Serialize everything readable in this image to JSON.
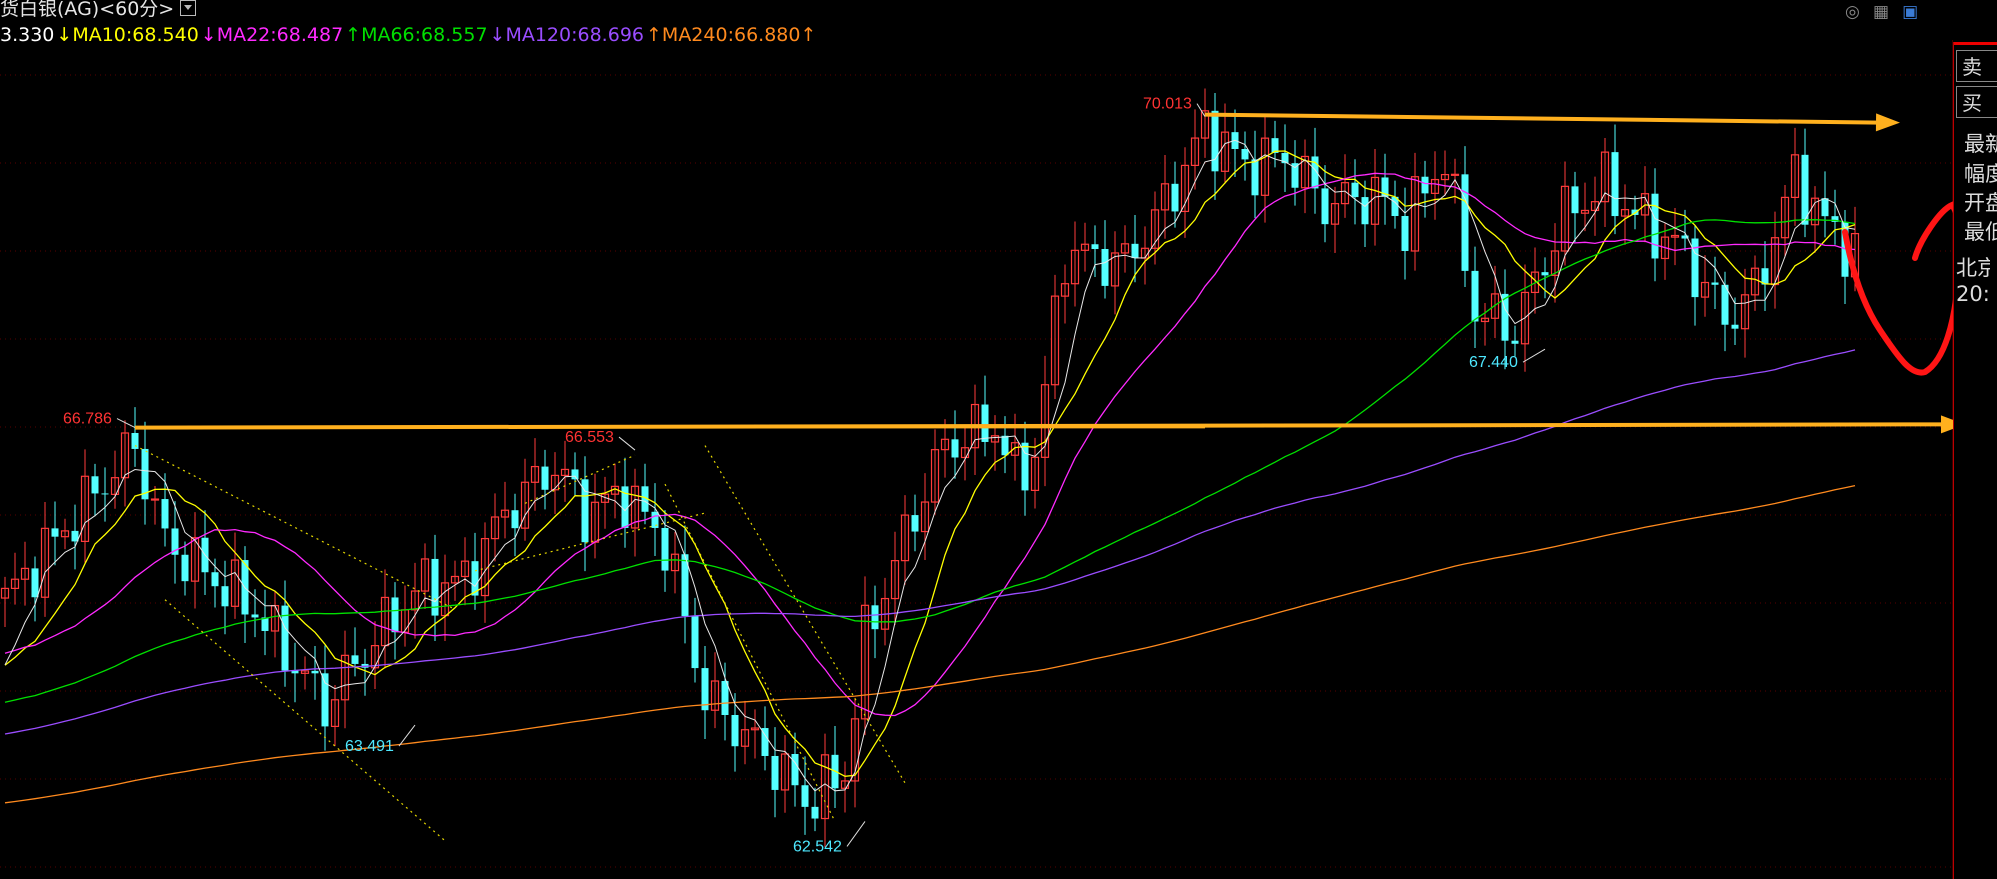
{
  "header": {
    "title": "货白银(AG)<60分>",
    "items": [
      {
        "text": "3.330",
        "color": "#ffffff"
      },
      {
        "text": "↓MA10:68.540",
        "color": "#ffff00"
      },
      {
        "text": "↓MA22:68.487",
        "color": "#ff2aff"
      },
      {
        "text": "↑MA66:68.557",
        "color": "#00e000"
      },
      {
        "text": "↓MA120:68.696",
        "color": "#9a4dff"
      },
      {
        "text": "↑MA240:66.880↑",
        "color": "#ff8a1e"
      }
    ]
  },
  "top_icons": [
    "eye-off-icon",
    "grid-icon",
    "layout-icon"
  ],
  "right_panel": {
    "buttons": [
      "卖出",
      "买入"
    ],
    "labels": [
      "最新",
      "幅度",
      "开盘",
      "最低",
      "北京",
      "20:"
    ]
  },
  "chart_data": {
    "type": "candlestick",
    "title": "",
    "annotations": [
      {
        "label": "70.013",
        "kind": "high",
        "color": "#ff3333"
      },
      {
        "label": "66.786",
        "kind": "high",
        "color": "#ff3333"
      },
      {
        "label": "66.553",
        "kind": "high",
        "color": "#ff3333"
      },
      {
        "label": "67.440",
        "kind": "low",
        "color": "#4ee8ff"
      },
      {
        "label": "63.491",
        "kind": "low",
        "color": "#4ee8ff"
      },
      {
        "label": "62.542",
        "kind": "low",
        "color": "#4ee8ff"
      }
    ],
    "ma_series": [
      {
        "name": "MA10",
        "color": "#ffff00"
      },
      {
        "name": "MA22",
        "color": "#ff2aff"
      },
      {
        "name": "MA66",
        "color": "#00e000"
      },
      {
        "name": "MA120",
        "color": "#9a4dff"
      },
      {
        "name": "MA240",
        "color": "#ff8a1e"
      }
    ],
    "key_points": [
      {
        "t": 0,
        "v": 65.0
      },
      {
        "t": 13,
        "v": 66.6
      },
      {
        "t": 16,
        "v": 65.6
      },
      {
        "t": 25,
        "v": 64.9
      },
      {
        "t": 32,
        "v": 63.9
      },
      {
        "t": 34,
        "v": 64.2
      },
      {
        "t": 41,
        "v": 65.1
      },
      {
        "t": 46,
        "v": 65.2
      },
      {
        "t": 50,
        "v": 65.9
      },
      {
        "t": 55,
        "v": 66.4
      },
      {
        "t": 58,
        "v": 65.9
      },
      {
        "t": 62,
        "v": 66.1
      },
      {
        "t": 66,
        "v": 65.6
      },
      {
        "t": 70,
        "v": 64.0
      },
      {
        "t": 77,
        "v": 63.3
      },
      {
        "t": 80,
        "v": 62.9
      },
      {
        "t": 84,
        "v": 63.2
      },
      {
        "t": 86,
        "v": 64.6
      },
      {
        "t": 91,
        "v": 65.9
      },
      {
        "t": 94,
        "v": 66.6
      },
      {
        "t": 99,
        "v": 66.8
      },
      {
        "t": 101,
        "v": 66.3
      },
      {
        "t": 103,
        "v": 66.5
      },
      {
        "t": 106,
        "v": 68.6
      },
      {
        "t": 112,
        "v": 68.5
      },
      {
        "t": 116,
        "v": 69.1
      },
      {
        "t": 120,
        "v": 69.9
      },
      {
        "t": 124,
        "v": 69.5
      },
      {
        "t": 128,
        "v": 69.6
      },
      {
        "t": 132,
        "v": 69.1
      },
      {
        "t": 137,
        "v": 69.2
      },
      {
        "t": 140,
        "v": 68.9
      },
      {
        "t": 144,
        "v": 69.6
      },
      {
        "t": 147,
        "v": 68.0
      },
      {
        "t": 151,
        "v": 67.8
      },
      {
        "t": 156,
        "v": 69.0
      },
      {
        "t": 160,
        "v": 69.3
      },
      {
        "t": 163,
        "v": 69.0
      },
      {
        "t": 168,
        "v": 68.6
      },
      {
        "t": 172,
        "v": 67.9
      },
      {
        "t": 175,
        "v": 68.2
      },
      {
        "t": 179,
        "v": 69.4
      },
      {
        "t": 182,
        "v": 68.9
      },
      {
        "t": 185,
        "v": 68.6
      }
    ],
    "ylim": [
      62.3,
      70.6
    ],
    "trendlines": [
      "resistance 70.013",
      "support 66.786"
    ]
  }
}
